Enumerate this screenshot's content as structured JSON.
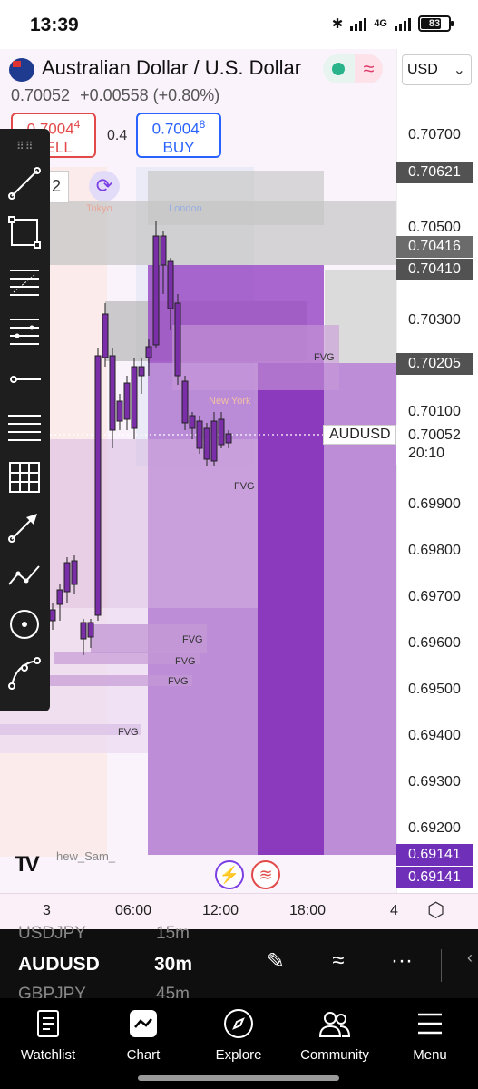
{
  "status_bar": {
    "time": "13:39",
    "network": "4G",
    "battery": "83"
  },
  "symbol": {
    "name": "Australian Dollar / U.S. Dollar",
    "currency": "USD",
    "last_price": "0.70052",
    "change": "+0.00558 (+0.80%)",
    "ticker": "AUDUSD",
    "countdown": "20:10"
  },
  "trade": {
    "sell_price_main": "0.7004",
    "sell_price_sup": "4",
    "sell_label": "SELL",
    "spread": "0.4",
    "buy_price_main": "0.7004",
    "buy_price_sup": "8",
    "buy_label": "BUY",
    "qty_field": "2"
  },
  "toolbar": {
    "tools": [
      "trend-line-icon",
      "rectangle-icon",
      "fib-retracement-icon",
      "fib-extension-icon",
      "horizontal-ray-icon",
      "parallel-channel-icon",
      "gann-box-icon",
      "arrow-icon",
      "path-icon",
      "circle-icon",
      "curve-icon"
    ]
  },
  "price_axis": {
    "ticks": [
      "0.70700",
      "0.70500",
      "0.70300",
      "0.70100",
      "0.69900",
      "0.69800",
      "0.69700",
      "0.69600",
      "0.69500",
      "0.69400",
      "0.69300",
      "0.69200"
    ],
    "labels": [
      {
        "value": "0.70621",
        "color": "#525252"
      },
      {
        "value": "0.70416",
        "color": "#6b6b6b"
      },
      {
        "value": "0.70410",
        "color": "#525252"
      },
      {
        "value": "0.70205",
        "color": "#525252"
      },
      {
        "value": "0.69141",
        "color": "#6f2fb8"
      },
      {
        "value": "0.69141",
        "color": "#6f2fb8"
      }
    ]
  },
  "time_axis": {
    "ticks": [
      "3",
      "06:00",
      "12:00",
      "18:00",
      "4"
    ]
  },
  "annotations": {
    "fvg_label": "FVG",
    "sessions": {
      "tokyo": "Tokyo",
      "london": "London",
      "new_york": "New York"
    },
    "watermark": "hew_Sam_"
  },
  "colors": {
    "purple_dark": "#8a3cc0",
    "purple_light": "#c08ad8",
    "grey_zone": "#c8c8c8",
    "sell": "#e24a4a",
    "buy": "#2962ff"
  },
  "picker": {
    "prev_symbol": "USDJPY",
    "prev_interval": "15m",
    "symbol": "AUDUSD",
    "interval": "30m",
    "next_symbol": "GBPJPY",
    "next_interval": "45m"
  },
  "nav": {
    "items": [
      {
        "label": "Watchlist",
        "icon": "watchlist-icon"
      },
      {
        "label": "Chart",
        "icon": "chart-icon"
      },
      {
        "label": "Explore",
        "icon": "compass-icon"
      },
      {
        "label": "Community",
        "icon": "community-icon"
      },
      {
        "label": "Menu",
        "icon": "menu-icon"
      }
    ]
  }
}
